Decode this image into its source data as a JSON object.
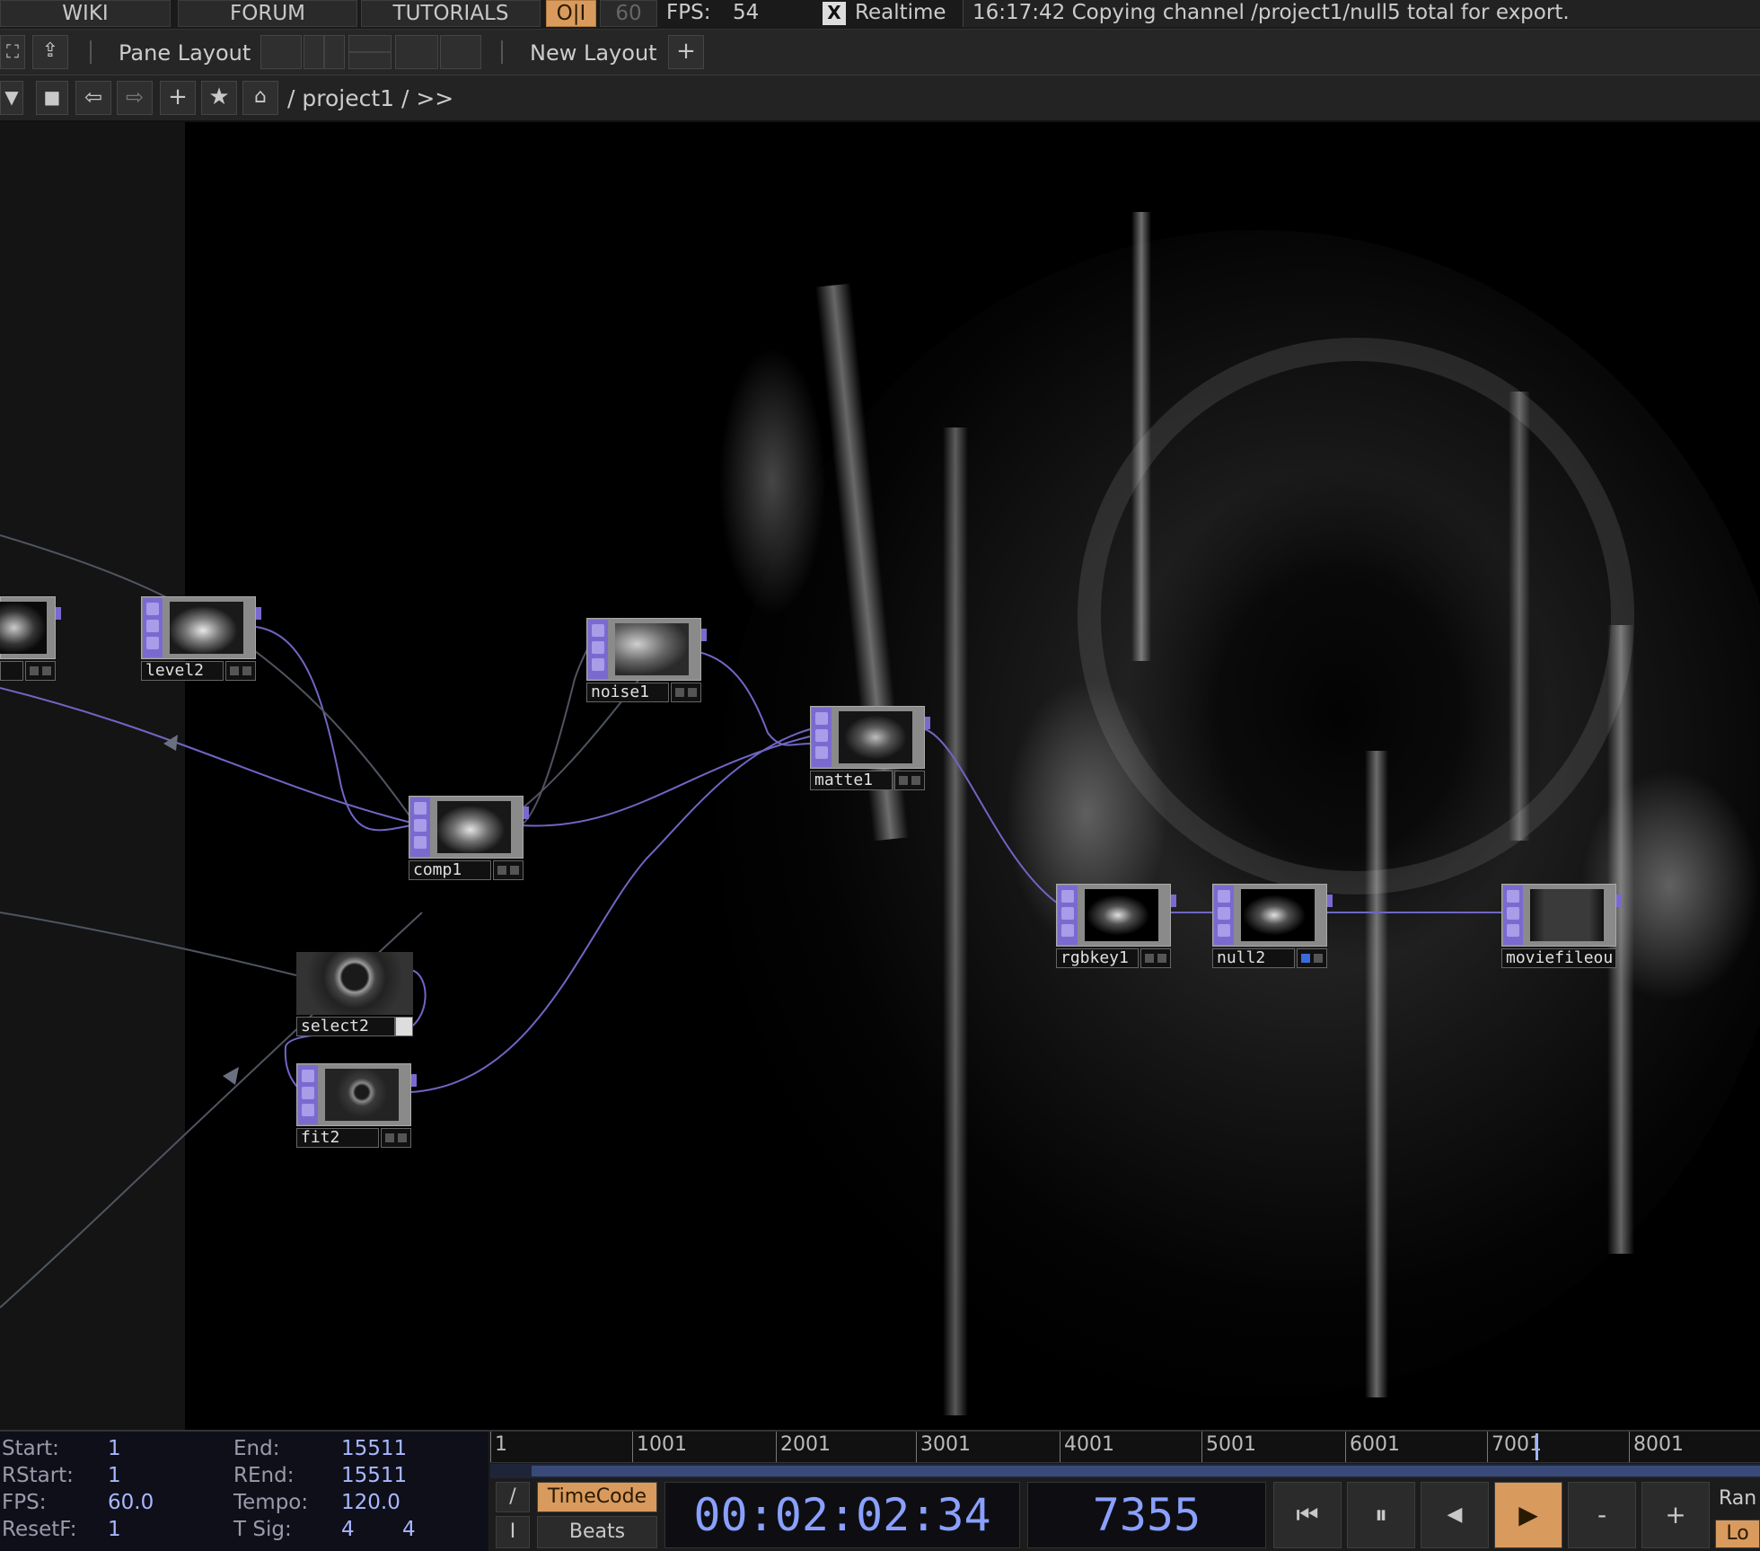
{
  "topbar": {
    "tabs": [
      "WIKI",
      "FORUM",
      "TUTORIALS"
    ],
    "perform_toggle": "O|I",
    "cook_rate": "60",
    "fps_label": "FPS:",
    "fps_value": "54",
    "realtime_check": "X",
    "realtime_label": "Realtime",
    "status_message": "16:17:42 Copying channel /project1/null5 total for export."
  },
  "pane_bar": {
    "pane_layout_label": "Pane Layout",
    "new_layout_label": "New Layout",
    "add_label": "+"
  },
  "path_bar": {
    "path": "/ project1 / >>",
    "add": "+",
    "star": "★"
  },
  "nodes": {
    "partial_left": "",
    "level2": "level2",
    "noise1": "noise1",
    "matte1": "matte1",
    "comp1": "comp1",
    "select2": "select2",
    "fit2": "fit2",
    "rgbkey1": "rgbkey1",
    "null2": "null2",
    "moviefileout": "moviefileou"
  },
  "range": {
    "start_label": "Start:",
    "start_value": "1",
    "rstart_label": "RStart:",
    "rstart_value": "1",
    "fps_label": "FPS:",
    "fps_value": "60.0",
    "resetf_label": "ResetF:",
    "resetf_value": "1",
    "end_label": "End:",
    "end_value": "15511",
    "rend_label": "REnd:",
    "rend_value": "15511",
    "tempo_label": "Tempo:",
    "tempo_value": "120.0",
    "tsig_label": "T Sig:",
    "tsig_num": "4",
    "tsig_den": "4"
  },
  "timeline": {
    "ticks": [
      "1",
      "1001",
      "2001",
      "3001",
      "4001",
      "5001",
      "6001",
      "7001",
      "8001"
    ],
    "playhead_frame": 7355
  },
  "transport": {
    "slash": "/",
    "bar": "I",
    "timecode_label": "TimeCode",
    "beats_label": "Beats",
    "timecode_value": "00:02:02:34",
    "frame_value": "7355",
    "to_start": "⏮",
    "pause": "⏸",
    "step_back": "◀",
    "play": "▶",
    "minus": "-",
    "plus": "+",
    "range_label": "Ran",
    "loop_label": "Lo"
  },
  "colors": {
    "accent_orange": "#d99a5e",
    "operator_purple": "#7a6ad0",
    "wire": "#6f66c4"
  }
}
